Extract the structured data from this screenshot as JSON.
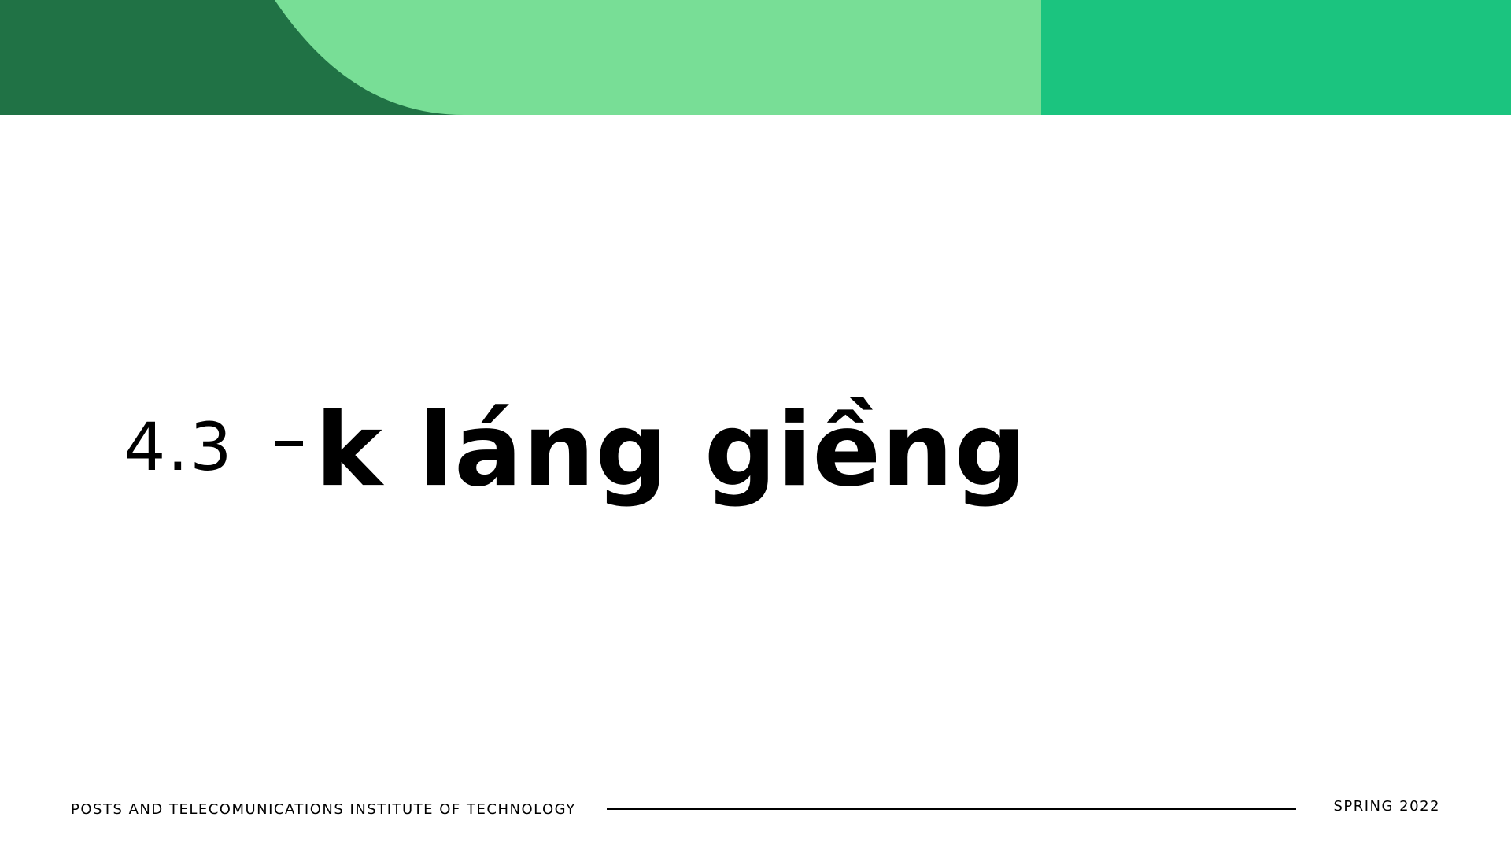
{
  "colors": {
    "dark_green": "#207245",
    "light_green": "#78DE96",
    "bright_green": "#1BC47F",
    "text": "#000000",
    "background": "#FFFFFF"
  },
  "title": {
    "number": "4.3",
    "text": "k láng giềng"
  },
  "footer": {
    "institution": "POSTS AND TELECOMUNICATIONS INSTITUTE OF TECHNOLOGY",
    "term": "SPRING 2022"
  }
}
